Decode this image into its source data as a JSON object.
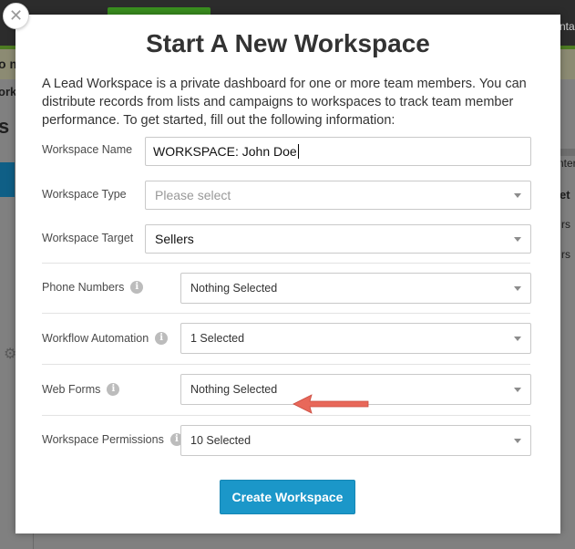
{
  "modal": {
    "title": "Start A New Workspace",
    "description": "A Lead Workspace is a private dashboard for one or more team members. You can distribute records from lists and campaigns to workspaces to track team member performance. To get started, fill out the following information:",
    "close_symbol": "✕",
    "fields": {
      "workspace_name": {
        "label": "Workspace Name",
        "value": "WORKSPACE: John Doe"
      },
      "workspace_type": {
        "label": "Workspace Type",
        "placeholder": "Please select"
      },
      "workspace_target": {
        "label": "Workspace Target",
        "value": "Sellers"
      },
      "phone_numbers": {
        "label": "Phone Numbers",
        "value": "Nothing Selected"
      },
      "workflow_automation": {
        "label": "Workflow Automation",
        "value": "1 Selected"
      },
      "web_forms": {
        "label": "Web Forms",
        "value": "Nothing Selected"
      },
      "workspace_permissions": {
        "label": "Workspace Permissions",
        "value": "10 Selected"
      }
    },
    "info_symbol": "i",
    "create_button_label": "Create Workspace"
  },
  "background": {
    "fragments": [
      "o m",
      "ork",
      "s",
      "nta",
      "nter",
      "et",
      "rs",
      "rs"
    ]
  },
  "colors": {
    "primary_button": "#1b97c9",
    "annotation_arrow": "#e8685a"
  }
}
